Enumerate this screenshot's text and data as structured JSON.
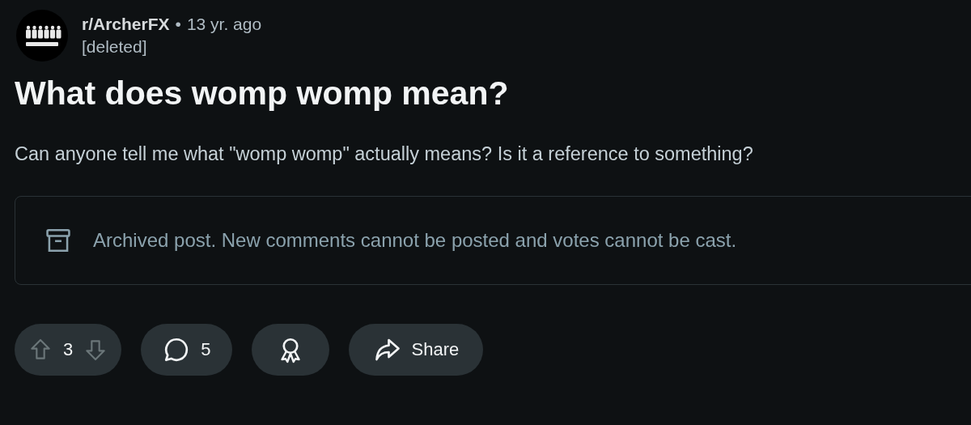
{
  "post": {
    "subreddit": "r/ArcherFX",
    "separator": "•",
    "age": "13 yr. ago",
    "author": "[deleted]",
    "title": "What does womp womp mean?",
    "body": "Can anyone tell me what \"womp womp\" actually means? Is it a reference to something?"
  },
  "notice": {
    "kind": "archived",
    "text": "Archived post. New comments cannot be posted and votes cannot be cast."
  },
  "actions": [
    {
      "kind": "vote",
      "count": "3",
      "disabled": true
    },
    {
      "kind": "comments",
      "count": "5"
    },
    {
      "kind": "award"
    },
    {
      "kind": "share",
      "label": "Share"
    }
  ]
}
